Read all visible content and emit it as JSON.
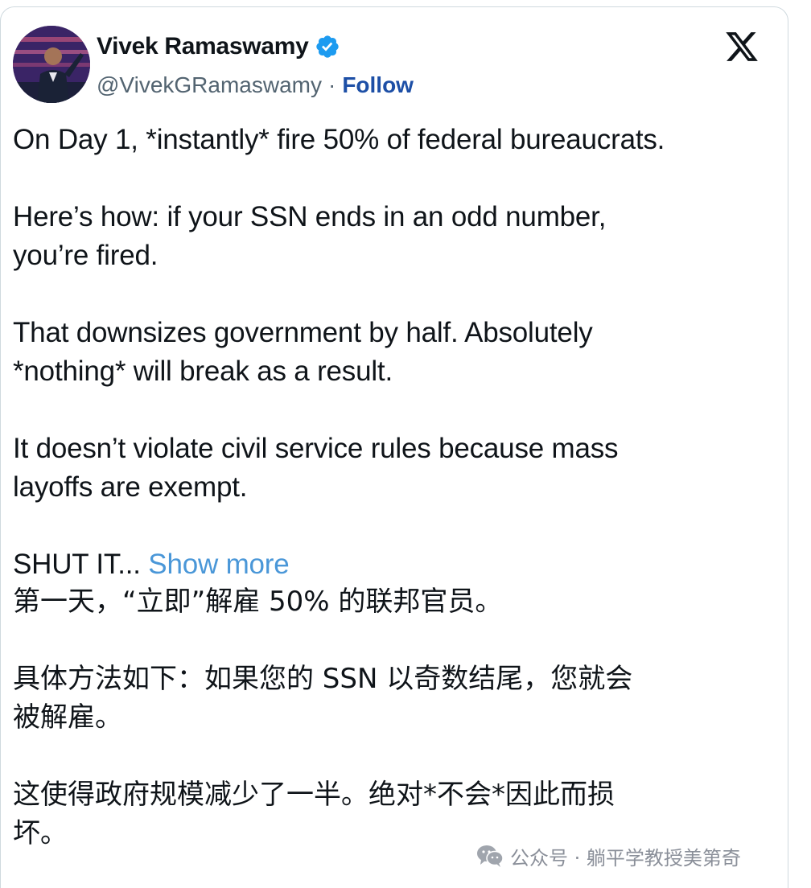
{
  "tweet": {
    "author": {
      "display_name": "Vivek Ramaswamy",
      "handle": "@VivekGRamaswamy",
      "separator": "·",
      "follow_label": "Follow",
      "verified": true
    },
    "platform_icon": "x-logo-icon",
    "paragraphs": [
      "On Day 1, *instantly* fire 50% of federal bureaucrats.",
      "Here’s how: if your SSN ends in an odd number,\nyou’re fired.",
      "That downsizes government by half. Absolutely\n*nothing* will break as a result.",
      "It doesn’t violate civil service rules because mass\nlayoffs are exempt."
    ],
    "truncated_text": "SHUT IT... ",
    "show_more_label": "Show more"
  },
  "translation": {
    "paragraphs": [
      "第一天，“立即”解雇 50% 的联邦官员。",
      "具体方法如下：如果您的 SSN 以奇数结尾，您就会\n被解雇。",
      "这使得政府规模减少了一半。绝对*不会*因此而损\n坏。"
    ]
  },
  "watermark": {
    "icon": "wechat-icon",
    "text": "公众号 · 躺平学教授美第奇"
  },
  "colors": {
    "verified_badge": "#1d9bf0",
    "follow_link": "#1d4fa6",
    "show_more_link": "#4a97d8",
    "secondary_text": "#536471"
  }
}
